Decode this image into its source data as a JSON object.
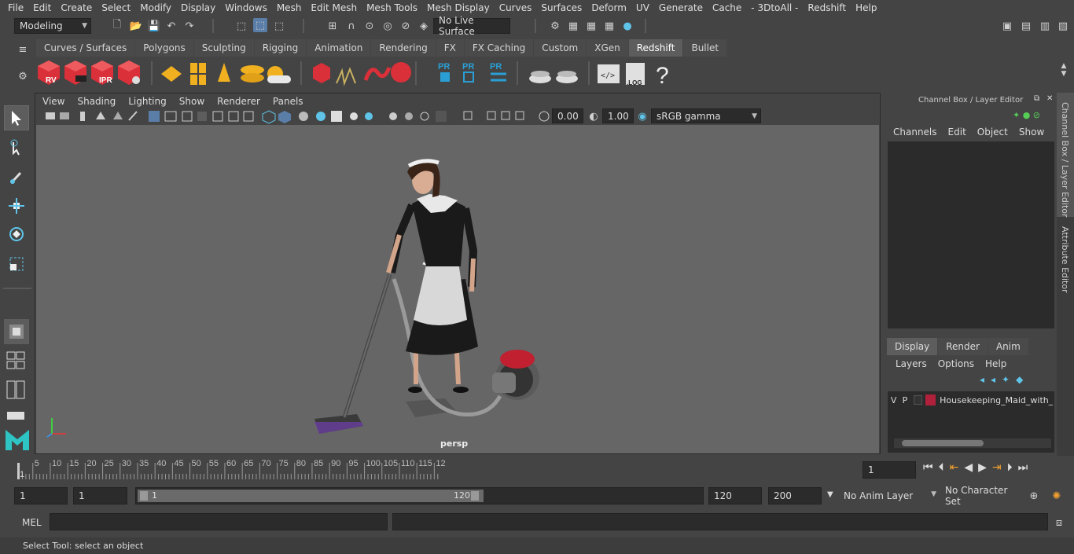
{
  "menu": [
    "File",
    "Edit",
    "Create",
    "Select",
    "Modify",
    "Display",
    "Windows",
    "Mesh",
    "Edit Mesh",
    "Mesh Tools",
    "Mesh Display",
    "Curves",
    "Surfaces",
    "Deform",
    "UV",
    "Generate",
    "Cache",
    "- 3DtoAll -",
    "Redshift",
    "Help"
  ],
  "status": {
    "mode": "Modeling",
    "live_surface": "No Live Surface"
  },
  "shelf_tabs": [
    "Curves / Surfaces",
    "Polygons",
    "Sculpting",
    "Rigging",
    "Animation",
    "Rendering",
    "FX",
    "FX Caching",
    "Custom",
    "XGen",
    "Redshift",
    "Bullet"
  ],
  "active_shelf_tab": "Redshift",
  "shelf_icons": {
    "rv": "RV",
    "ipr": "IPR",
    "pr": "PR",
    "log": ".LOG",
    "help": "?"
  },
  "viewport": {
    "menu": [
      "View",
      "Shading",
      "Lighting",
      "Show",
      "Renderer",
      "Panels"
    ],
    "exposure": "0.00",
    "gamma": "1.00",
    "color_space": "sRGB gamma",
    "camera": "persp"
  },
  "channel_box": {
    "title": "Channel Box / Layer Editor",
    "menu": [
      "Channels",
      "Edit",
      "Object",
      "Show"
    ],
    "layer_tabs": [
      "Display",
      "Render",
      "Anim"
    ],
    "active_layer_tab": "Display",
    "layer_menu": [
      "Layers",
      "Options",
      "Help"
    ],
    "layer": {
      "v": "V",
      "p": "P",
      "name": "Housekeeping_Maid_with_D",
      "color": "#b0203a"
    }
  },
  "side_tabs": [
    "Channel Box / Layer Editor",
    "Attribute Editor"
  ],
  "timeline": {
    "ticks": [
      "5",
      "10",
      "15",
      "20",
      "25",
      "30",
      "35",
      "40",
      "45",
      "50",
      "55",
      "60",
      "65",
      "70",
      "75",
      "80",
      "85",
      "90",
      "95",
      "100",
      "105",
      "110",
      "115",
      "12"
    ],
    "start_label": "1",
    "current_frame": "1"
  },
  "range": {
    "start": "1",
    "start2": "1",
    "slider_start": "1",
    "slider_end": "120",
    "end": "120",
    "end2": "200",
    "anim_layer": "No Anim Layer",
    "char_set": "No Character Set"
  },
  "command": {
    "lang": "MEL"
  },
  "help_line": "Select Tool: select an object",
  "colors": {
    "accent": "#5d5d5d",
    "redshift_red": "#d9303a",
    "pr_blue": "#2a9fd6",
    "gold": "#f0b020"
  }
}
